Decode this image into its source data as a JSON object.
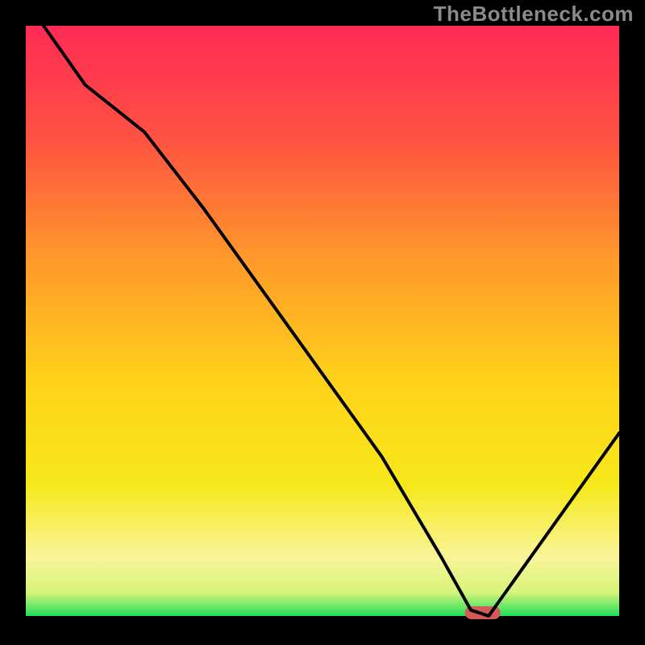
{
  "watermark": "TheBottleneck.com",
  "chart_data": {
    "type": "line",
    "title": "",
    "xlabel": "",
    "ylabel": "",
    "xlim": [
      0,
      100
    ],
    "ylim": [
      0,
      100
    ],
    "x": [
      3,
      10,
      20,
      30,
      40,
      50,
      60,
      70,
      75,
      78,
      100
    ],
    "values": [
      100,
      90,
      82,
      69,
      55,
      41,
      27,
      10,
      1,
      0,
      31
    ],
    "optimal_zone": {
      "x_start": 74,
      "x_end": 80,
      "y": 0
    },
    "background": {
      "gradient_stops": [
        {
          "offset": 0.0,
          "color": "#ff2b56"
        },
        {
          "offset": 0.18,
          "color": "#ff4f44"
        },
        {
          "offset": 0.4,
          "color": "#ff9a2a"
        },
        {
          "offset": 0.6,
          "color": "#ffd21a"
        },
        {
          "offset": 0.78,
          "color": "#f6e81a"
        },
        {
          "offset": 0.9,
          "color": "#f9f59a"
        },
        {
          "offset": 0.96,
          "color": "#d7f47a"
        },
        {
          "offset": 1.0,
          "color": "#1edf5a"
        }
      ]
    },
    "frame": {
      "color": "#000000",
      "thickness_top": 32,
      "thickness_sides": 32,
      "thickness_bottom": 6
    }
  }
}
